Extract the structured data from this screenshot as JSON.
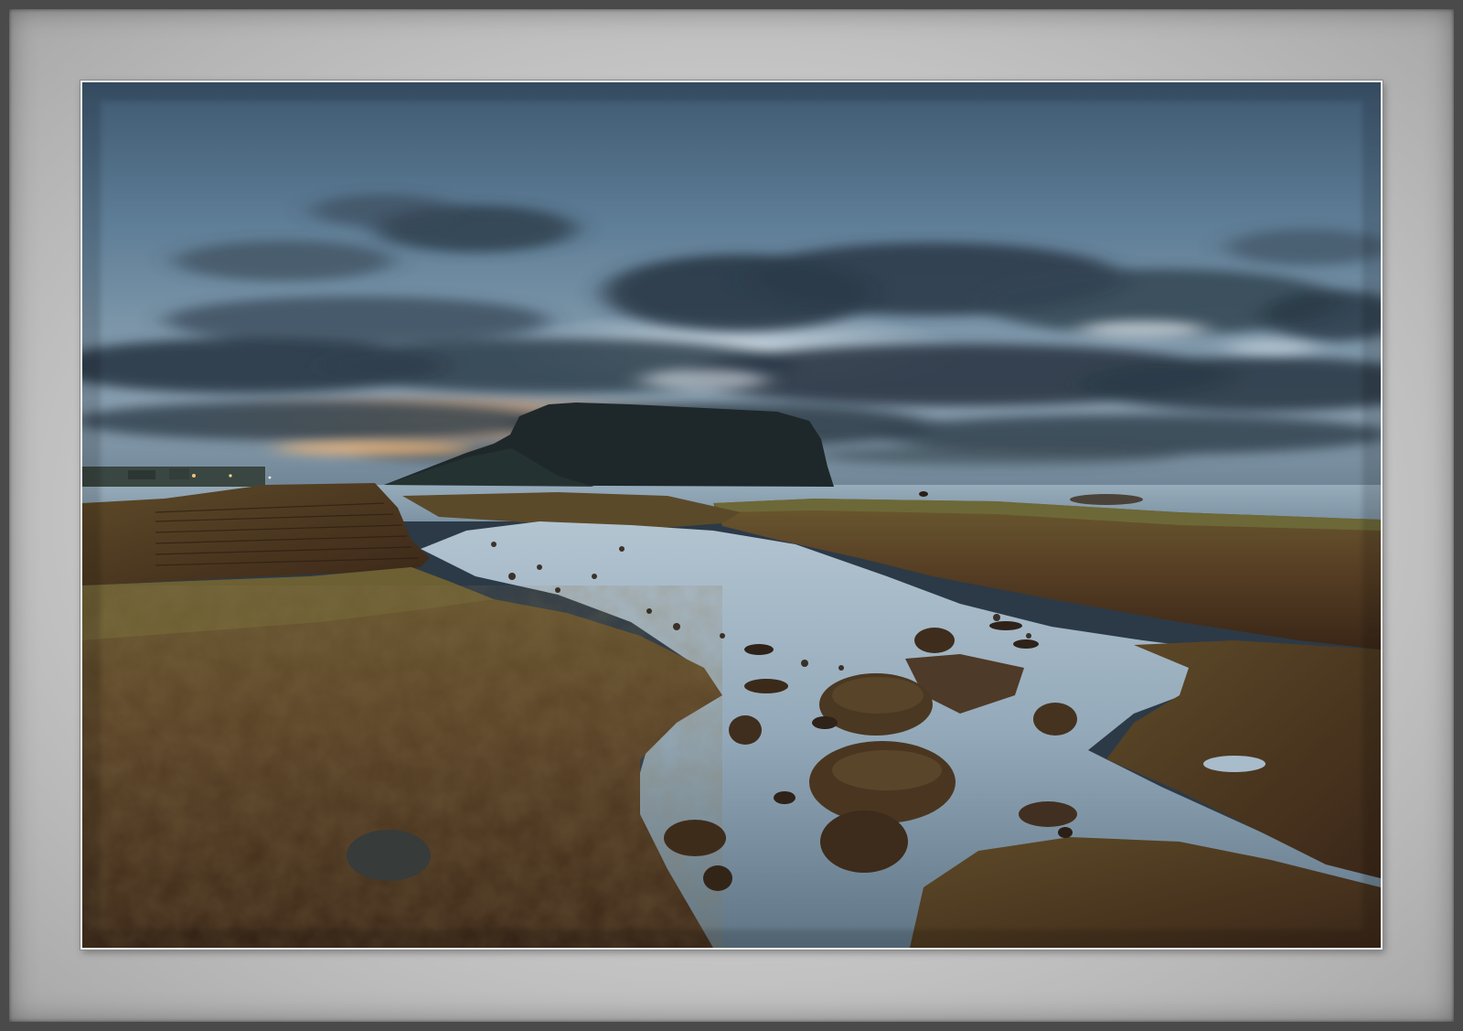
{
  "scene": {
    "description_tags": [
      "sky-icon",
      "clouds-icon",
      "mountain-icon",
      "sea-icon",
      "rock-icon",
      "tidepool-icon"
    ],
    "colors": {
      "frame_dark": "#4a4a4a",
      "mat_light": "#d4d4d4",
      "sky_top": "#3f5a73",
      "sky_mid": "#6f8ea6",
      "sky_horizon": "#8fa7b8",
      "sunset_glow": "#e2a56a",
      "cloud_dark": "#2c3b49",
      "headland": "#1f2a2c",
      "sea": "#8ea4b3",
      "tidepool": "#a9bccb",
      "rock_dark": "#3b2a1c",
      "rock_moss": "#6b5a2c",
      "rock_rust": "#5a3a22"
    }
  }
}
